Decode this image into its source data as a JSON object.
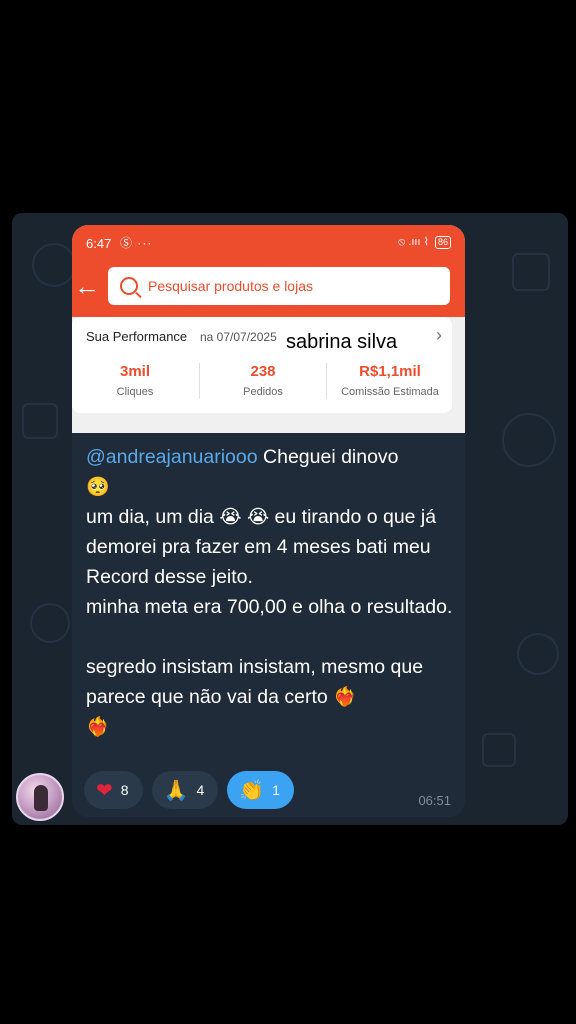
{
  "status_bar": {
    "time": "6:47",
    "left_icons": "Ⓢ ···",
    "right_icons": "⦸ .ııı ⌇",
    "battery": "86"
  },
  "search": {
    "placeholder": "Pesquisar produtos e lojas"
  },
  "performance": {
    "title": "Sua Performance",
    "date": "na 07/07/2025",
    "overlay_name": "sabrina silva",
    "stats": [
      {
        "value": "3mil",
        "label": "Cliques"
      },
      {
        "value": "238",
        "label": "Pedidos"
      },
      {
        "value": "R$1,1mil",
        "label": "Comissão Estimada"
      }
    ]
  },
  "message": {
    "mention": "@andreajanuariooo",
    "line1_rest": " Cheguei dinovo",
    "emoji_pleading": "🥺",
    "line2_a": "um dia, um dia ",
    "emoji_cry": "😭",
    "line2_b": " eu tirando o que já demorei pra fazer em 4 meses bati meu Record desse jeito.",
    "line3": "minha meta era 700,00 e olha o resultado.",
    "line4": "segredo insistam insistam, mesmo que parece que não vai da certo ",
    "emoji_heart_fire": "❤️‍🔥",
    "time": "06:51"
  },
  "reactions": [
    {
      "emoji": "❤",
      "icon": "heart-icon",
      "count": "8"
    },
    {
      "emoji": "🙏",
      "icon": "pray-icon",
      "count": "4"
    },
    {
      "emoji": "👏",
      "icon": "clap-icon",
      "count": "1"
    }
  ],
  "colors": {
    "brand": "#ee4d2d",
    "mention": "#5aa9ea",
    "active_reaction": "#3ba3f2",
    "chat_bg": "#1a2530"
  }
}
